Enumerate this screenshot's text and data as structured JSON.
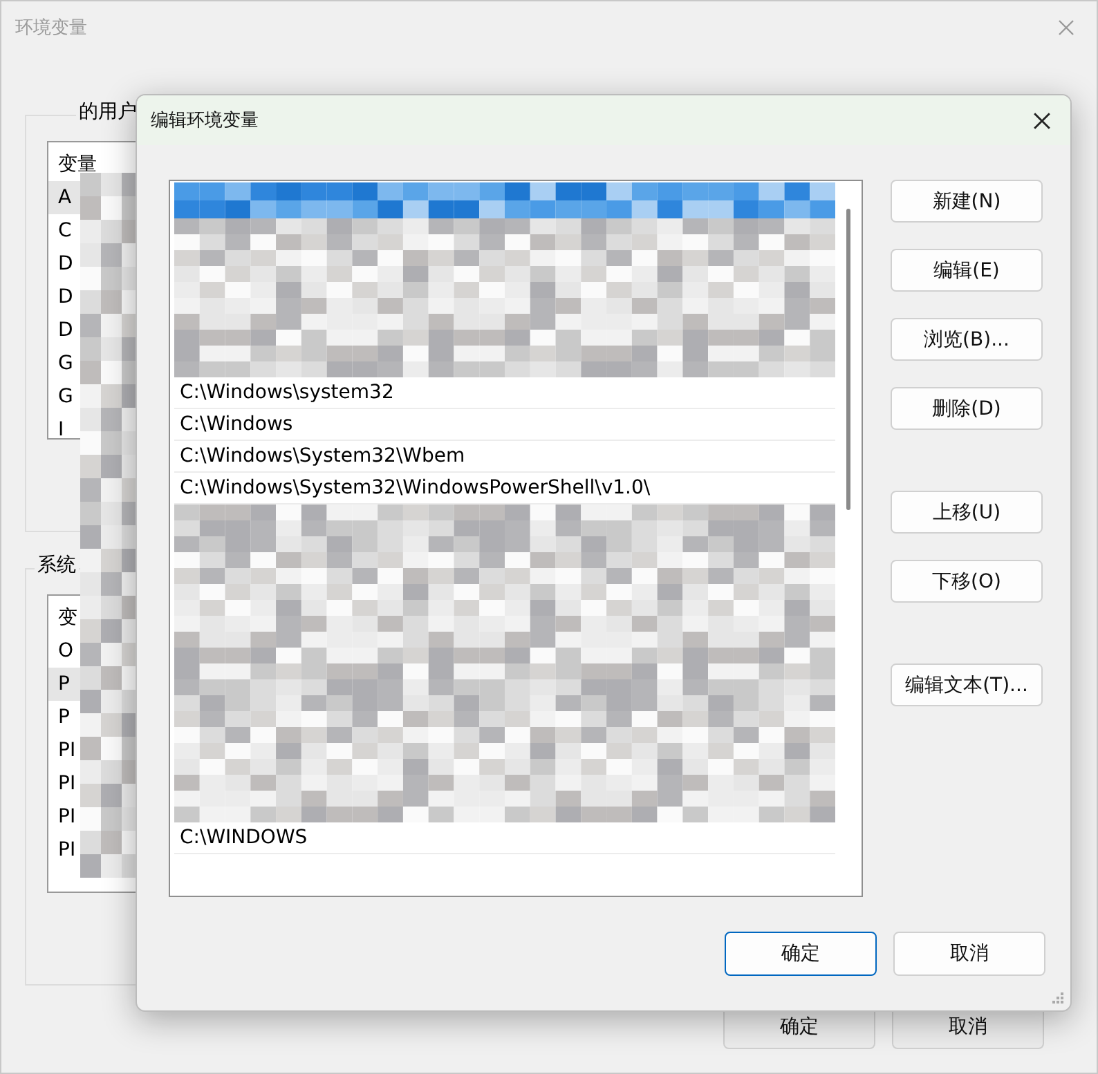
{
  "window": {
    "title": "环境变量",
    "user_group": "的用户",
    "user_list": {
      "header": "变量",
      "items": [
        {
          "text": "A",
          "selected": true
        },
        {
          "text": "C",
          "selected": false
        },
        {
          "text": "D",
          "selected": false
        },
        {
          "text": "D",
          "selected": false
        },
        {
          "text": "D",
          "selected": false
        },
        {
          "text": "G",
          "selected": false
        },
        {
          "text": "G",
          "selected": false
        },
        {
          "text": "I",
          "selected": false
        }
      ]
    },
    "system_group": "系统",
    "system_list": {
      "header": "变",
      "items": [
        {
          "text": "O",
          "selected": false
        },
        {
          "text": "P",
          "selected": true
        },
        {
          "text": "P",
          "selected": false
        },
        {
          "text": "PI",
          "selected": false
        },
        {
          "text": "PI",
          "selected": false
        },
        {
          "text": "PI",
          "selected": false
        },
        {
          "text": "PI",
          "selected": false
        }
      ]
    },
    "buttons": [
      "确定",
      "取消"
    ]
  },
  "dialog": {
    "title": "编辑环境变量",
    "rows": [
      {
        "kind": "redacted",
        "selected": true
      },
      {
        "kind": "redacted",
        "selected": false
      },
      {
        "kind": "redacted",
        "selected": false
      },
      {
        "kind": "redacted",
        "selected": false
      },
      {
        "kind": "redacted",
        "selected": false
      },
      {
        "kind": "redacted",
        "selected": false
      },
      {
        "kind": "path",
        "text": "C:\\Windows\\system32",
        "selected": false
      },
      {
        "kind": "path",
        "text": "C:\\Windows",
        "selected": false
      },
      {
        "kind": "path",
        "text": "C:\\Windows\\System32\\Wbem",
        "selected": false
      },
      {
        "kind": "path",
        "text": "C:\\Windows\\System32\\WindowsPowerShell\\v1.0\\",
        "selected": false
      },
      {
        "kind": "redacted",
        "selected": false
      },
      {
        "kind": "redacted",
        "selected": false
      },
      {
        "kind": "redacted",
        "selected": false
      },
      {
        "kind": "redacted",
        "selected": false
      },
      {
        "kind": "redacted",
        "selected": false
      },
      {
        "kind": "redacted",
        "selected": false
      },
      {
        "kind": "redacted",
        "selected": false
      },
      {
        "kind": "redacted",
        "selected": false
      },
      {
        "kind": "redacted",
        "selected": false
      },
      {
        "kind": "redacted",
        "selected": false
      },
      {
        "kind": "path",
        "text": "C:\\WINDOWS",
        "selected": false
      }
    ],
    "side_buttons": [
      [
        "新建(N)",
        "编辑(E)",
        "浏览(B)...",
        "删除(D)"
      ],
      [
        "上移(U)",
        "下移(O)"
      ],
      [
        "编辑文本(T)..."
      ]
    ],
    "ok": "确定",
    "cancel": "取消"
  }
}
